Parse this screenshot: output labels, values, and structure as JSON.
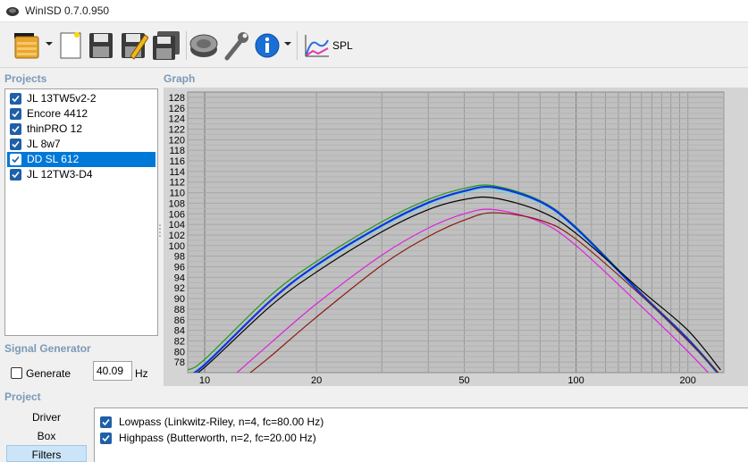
{
  "window": {
    "title": "WinISD 0.7.0.950"
  },
  "toolbar": {
    "items": [
      {
        "name": "open-project-button",
        "icon": "folder-open-icon"
      },
      {
        "name": "new-project-button",
        "icon": "new-document-icon"
      },
      {
        "name": "save-button",
        "icon": "floppy-disk-icon"
      },
      {
        "name": "save-as-button",
        "icon": "floppy-pencil-icon"
      },
      {
        "name": "save-all-button",
        "icon": "floppy-disks-icon"
      },
      {
        "name": "driver-editor-button",
        "icon": "speaker-icon"
      },
      {
        "name": "tools-button",
        "icon": "wrench-icon"
      },
      {
        "name": "info-button",
        "icon": "info-icon"
      },
      {
        "name": "spl-button",
        "icon": "spl-graph-icon"
      }
    ],
    "spl_label": "SPL"
  },
  "projects": {
    "label": "Projects",
    "items": [
      {
        "label": "JL 13TW5v2-2",
        "checked": true,
        "selected": false
      },
      {
        "label": "Encore 4412",
        "checked": true,
        "selected": false
      },
      {
        "label": "thinPRO 12",
        "checked": true,
        "selected": false
      },
      {
        "label": "JL 8w7",
        "checked": true,
        "selected": false
      },
      {
        "label": "DD SL 612",
        "checked": true,
        "selected": true
      },
      {
        "label": "JL 12TW3-D4",
        "checked": true,
        "selected": false
      }
    ]
  },
  "signal_generator": {
    "label": "Signal Generator",
    "generate_label": "Generate",
    "generate_checked": false,
    "frequency": "40.09",
    "unit": "Hz"
  },
  "graph": {
    "label": "Graph"
  },
  "chart_data": {
    "type": "line",
    "title": "",
    "xlabel": "",
    "ylabel": "",
    "x_scale": "log",
    "xlim": [
      9,
      250
    ],
    "ylim": [
      76,
      129
    ],
    "x_ticks": [
      {
        "value": 10,
        "label": "10"
      },
      {
        "value": 20,
        "label": "20"
      },
      {
        "value": 50,
        "label": "50"
      },
      {
        "value": 100,
        "label": "100"
      },
      {
        "value": 200,
        "label": "200"
      }
    ],
    "y_ticks": [
      "78",
      "80",
      "82",
      "84",
      "86",
      "88",
      "90",
      "92",
      "94",
      "96",
      "98",
      "100",
      "102",
      "104",
      "106",
      "108",
      "110",
      "112",
      "114",
      "116",
      "118",
      "120",
      "122",
      "124",
      "126",
      "128"
    ],
    "grid": true,
    "series": [
      {
        "color": "#1a9a1a",
        "x": [
          9,
          10,
          15,
          20,
          30,
          40,
          50,
          60,
          80,
          100,
          150,
          200,
          245
        ],
        "y": [
          76.5,
          78.5,
          90.5,
          97,
          104.5,
          108.7,
          110.8,
          111.3,
          108.5,
          103.5,
          91,
          82.5,
          75.5
        ]
      },
      {
        "color": "#6fd6e6",
        "x": [
          9,
          10,
          15,
          20,
          30,
          40,
          50,
          60,
          80,
          100,
          150,
          200,
          245
        ],
        "y": [
          75.5,
          77.7,
          89.5,
          96,
          103.5,
          107.7,
          110,
          110.5,
          108,
          103,
          90.5,
          82,
          75
        ]
      },
      {
        "color": "#1033e0",
        "x": [
          9,
          10,
          15,
          20,
          30,
          40,
          50,
          60,
          80,
          100,
          150,
          200,
          245
        ],
        "y": [
          75.5,
          77.5,
          89.5,
          96.3,
          103.8,
          108.1,
          110.3,
          111,
          108.3,
          103.3,
          90.8,
          82.3,
          75.3
        ]
      },
      {
        "color": "#000000",
        "x": [
          9,
          10,
          15,
          20,
          30,
          40,
          50,
          60,
          80,
          100,
          150,
          200,
          245
        ],
        "y": [
          75,
          77,
          88.5,
          95,
          102.6,
          106.8,
          108.7,
          109,
          106.5,
          102.3,
          91.5,
          84,
          76.5
        ]
      },
      {
        "color": "#e020e0",
        "x": [
          12,
          15,
          20,
          30,
          40,
          50,
          60,
          80,
          100,
          150,
          200,
          245
        ],
        "y": [
          75.5,
          81.5,
          89,
          98.2,
          103.3,
          106,
          106.8,
          104.5,
          100,
          88.5,
          80,
          73.5
        ]
      },
      {
        "color": "#8b1a1a",
        "x": [
          13,
          15,
          20,
          30,
          40,
          50,
          60,
          80,
          100,
          150,
          200,
          245
        ],
        "y": [
          75.5,
          79,
          86.5,
          96.3,
          101.7,
          104.8,
          106.2,
          104.8,
          101.2,
          90.5,
          82,
          75.5
        ]
      }
    ]
  },
  "project_panel": {
    "label": "Project",
    "tabs": [
      {
        "label": "Driver",
        "active": false
      },
      {
        "label": "Box",
        "active": false
      },
      {
        "label": "Filters",
        "active": true
      }
    ]
  },
  "filters": {
    "items": [
      {
        "label": "Lowpass (Linkwitz-Riley, n=4, fc=80.00 Hz)",
        "checked": true
      },
      {
        "label": "Highpass (Butterworth, n=2, fc=20.00 Hz)",
        "checked": true
      }
    ]
  }
}
